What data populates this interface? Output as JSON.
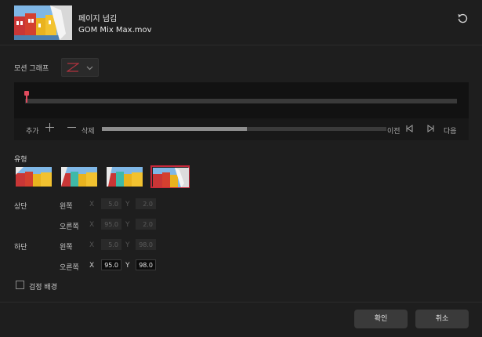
{
  "header": {
    "title": "페이지 넘김",
    "filename": "GOM Mix Max.mov",
    "reset_icon": "refresh-icon"
  },
  "motion_graph": {
    "label": "모션 그래프",
    "selected_icon": "z-curve-icon",
    "dropdown_icon": "chevron-down-icon",
    "accent": "#e04b5e"
  },
  "controls": {
    "add": "추가",
    "delete": "삭제",
    "prev": "이전",
    "next": "다음",
    "slider_value": 0.51
  },
  "type": {
    "label": "유형",
    "options": [
      "page-curl-left",
      "page-curl-right",
      "page-curl-bottom",
      "page-curl-top-right"
    ],
    "selected_index": 3,
    "selected_color": "#c8283b"
  },
  "top": {
    "label": "상단",
    "left": {
      "label": "왼쪽",
      "x": "5.0",
      "y": "2.0"
    },
    "right": {
      "label": "오른쪽",
      "x": "95.0",
      "y": "2.0"
    }
  },
  "bottom": {
    "label": "하단",
    "left": {
      "label": "왼쪽",
      "x": "5.0",
      "y": "98.0"
    },
    "right": {
      "label": "오른쪽",
      "x": "95.0",
      "y": "98.0"
    }
  },
  "axis": {
    "x": "X",
    "y": "Y"
  },
  "black_bg": {
    "label": "검정 배경",
    "checked": false
  },
  "buttons": {
    "ok": "확인",
    "cancel": "취소"
  }
}
